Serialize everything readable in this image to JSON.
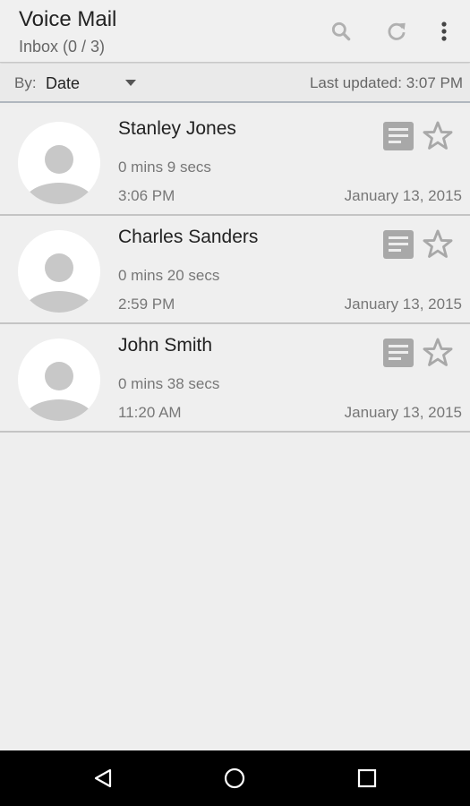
{
  "header": {
    "title": "Voice Mail",
    "subtitle": "Inbox (0 / 3)",
    "icons": [
      "search-icon",
      "refresh-icon",
      "overflow-menu-icon"
    ]
  },
  "sort_bar": {
    "label": "By:",
    "selected": "Date",
    "last_updated": "Last updated: 3:07 PM"
  },
  "messages": [
    {
      "name": "Stanley Jones",
      "duration": "0 mins 9 secs",
      "time": "3:06 PM",
      "date": "January 13, 2015"
    },
    {
      "name": "Charles Sanders",
      "duration": "0 mins 20 secs",
      "time": "2:59 PM",
      "date": "January 13, 2015"
    },
    {
      "name": "John Smith",
      "duration": "0 mins 38 secs",
      "time": "11:20 AM",
      "date": "January 13, 2015"
    }
  ],
  "navigation": {
    "icons": [
      "back-icon",
      "home-icon",
      "recents-icon"
    ]
  },
  "colors": {
    "background": "#eeeeee",
    "action_bar": "#f0f0f0",
    "icon_gray": "#aaaaaa",
    "nav_bar": "#000000"
  }
}
